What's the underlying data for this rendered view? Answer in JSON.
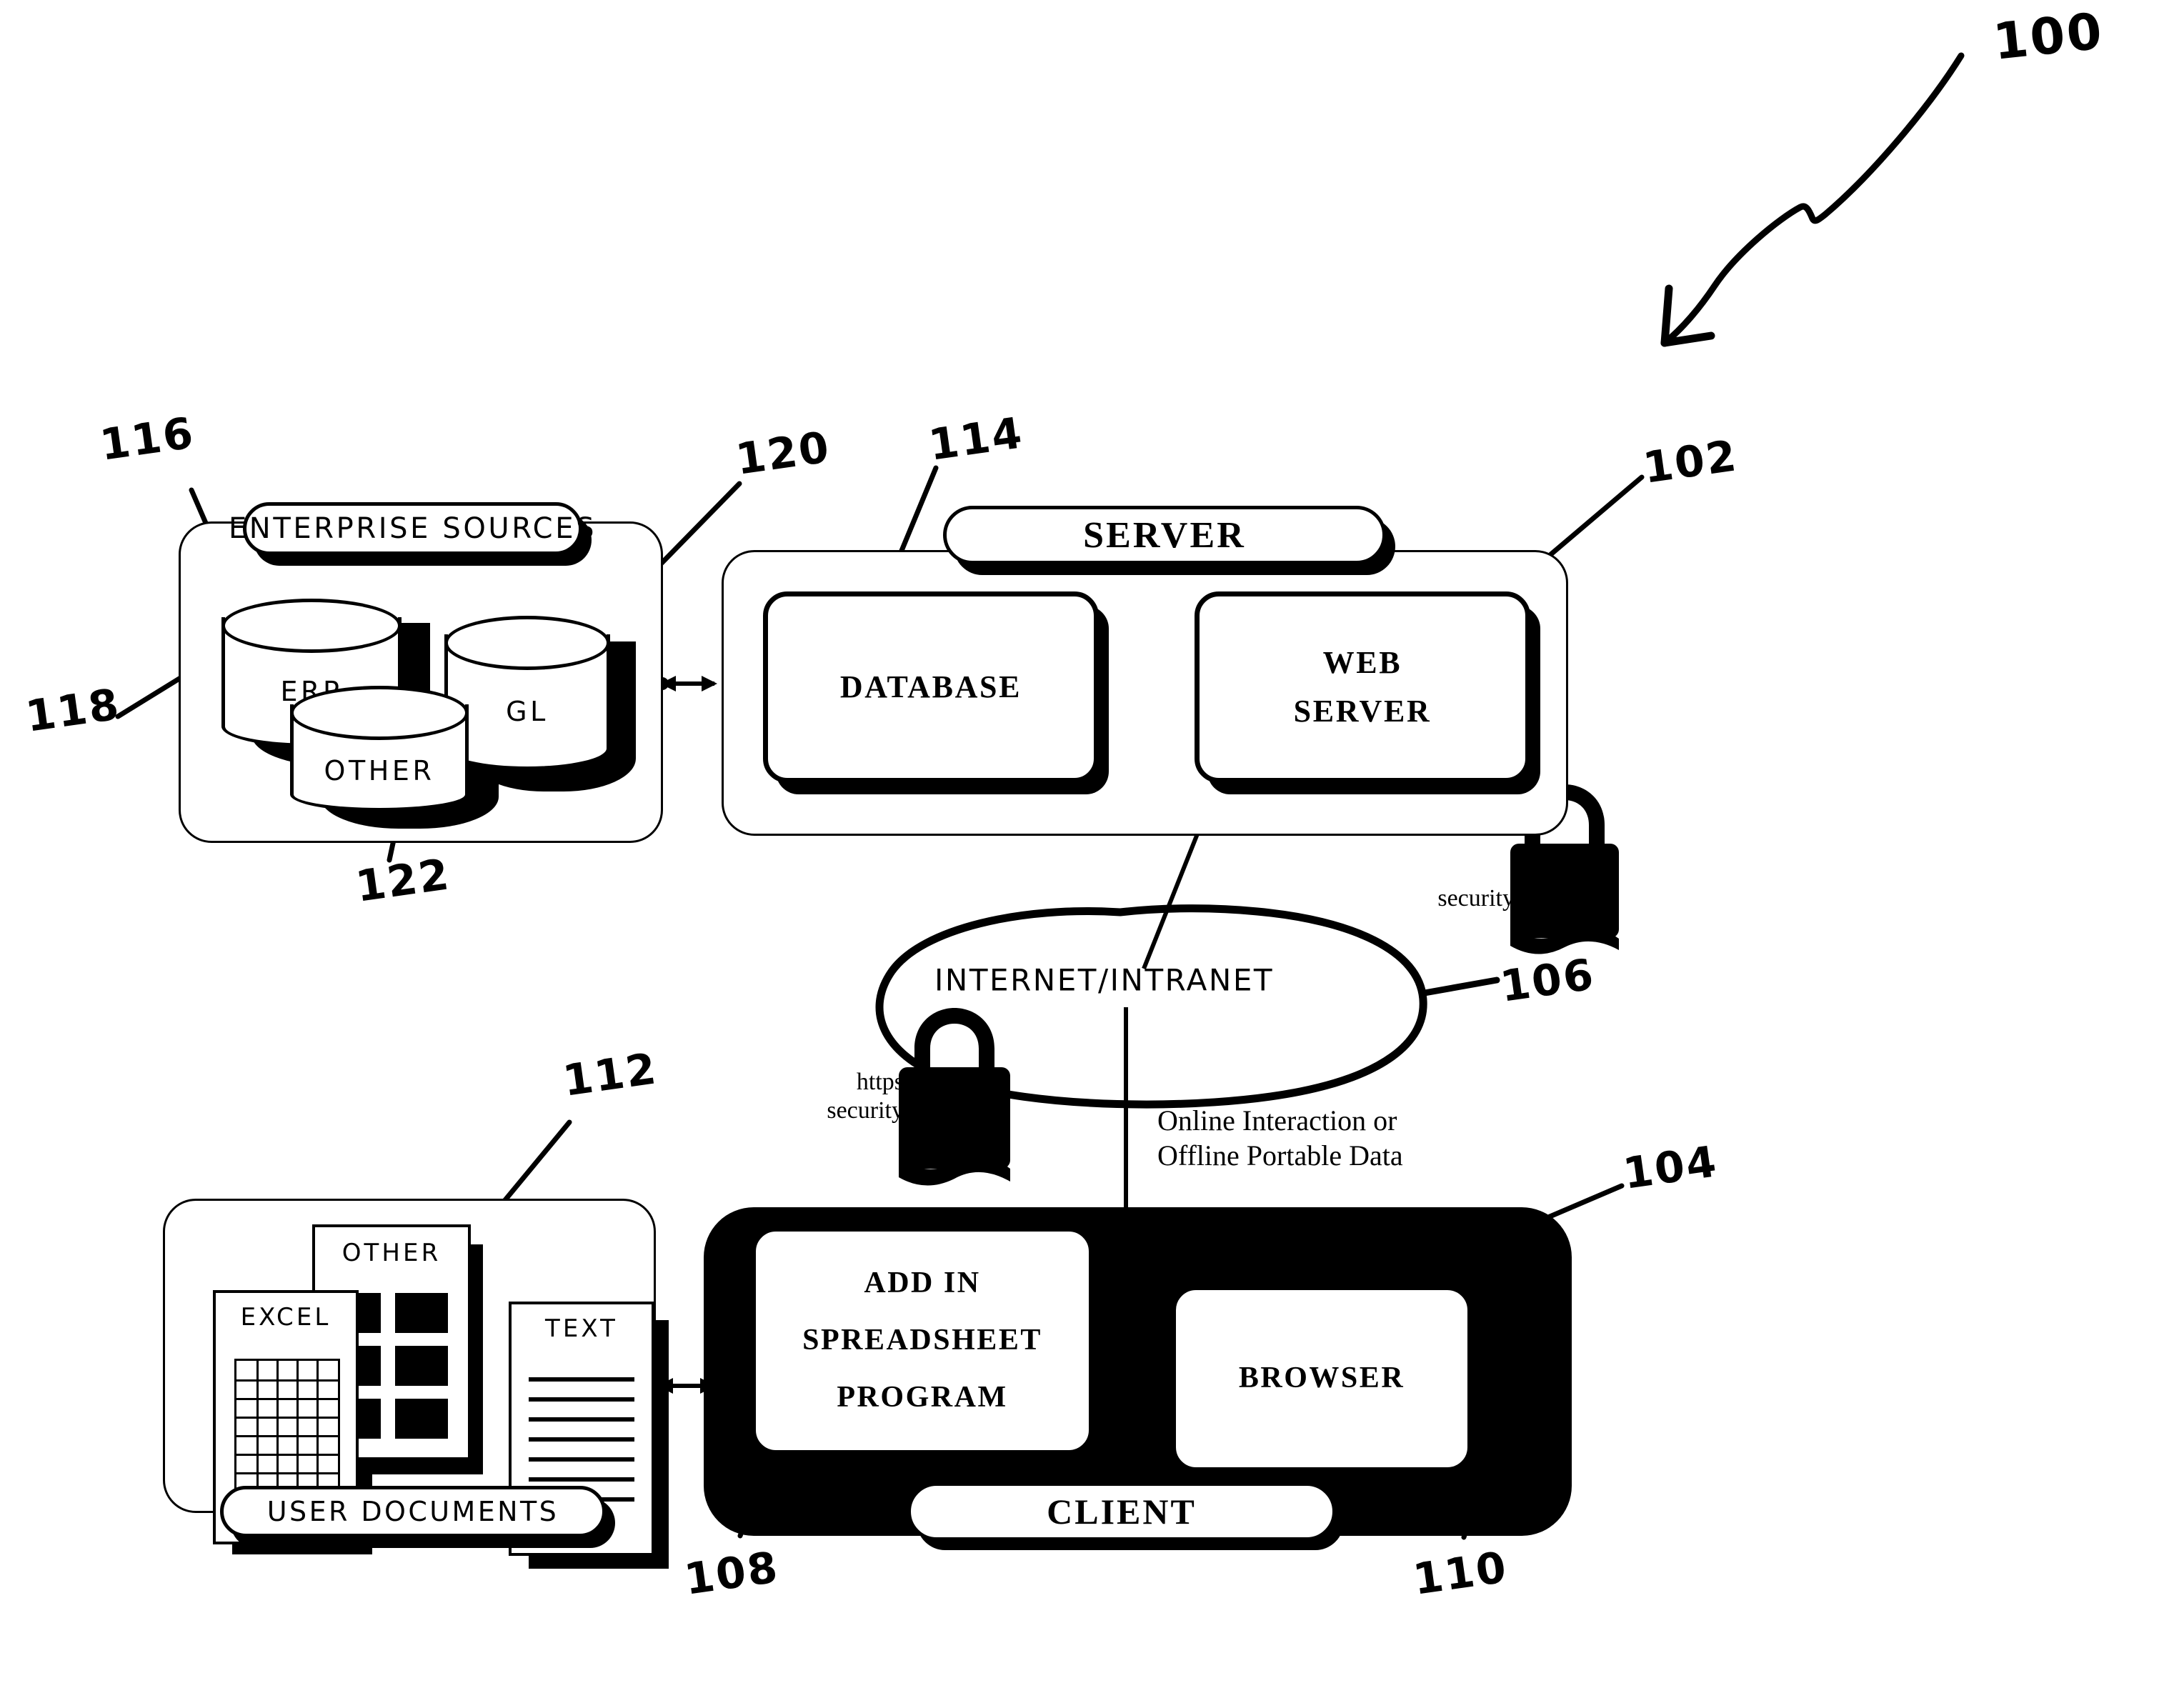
{
  "figure": {
    "reference_numeral": "100"
  },
  "refs": {
    "system": "100",
    "web_server": "102",
    "client": "104",
    "network": "106",
    "add_in_spreadsheet_program": "108",
    "browser": "110",
    "user_documents": "112",
    "database": "114",
    "enterprise_sources": "116",
    "erp": "118",
    "gl": "120",
    "other": "122"
  },
  "enterprise_sources": {
    "title": "ENTERPRISE SOURCES",
    "sources": [
      {
        "label": "ERP"
      },
      {
        "label": "GL"
      },
      {
        "label": "OTHER"
      }
    ]
  },
  "server": {
    "title": "SERVER",
    "nodes": [
      {
        "label": "DATABASE"
      },
      {
        "label": "WEB\nSERVER"
      }
    ],
    "security_label": "security",
    "security_icon": "padlock-icon"
  },
  "network": {
    "label": "INTERNET/INTRANET",
    "security_label": "https\nsecurity",
    "security_icon": "padlock-icon",
    "flow_label": "Online Interaction or\nOffline Portable Data"
  },
  "client": {
    "title": "CLIENT",
    "nodes": [
      {
        "label": "ADD IN\nSPREADSHEET\nPROGRAM"
      },
      {
        "label": "BROWSER"
      }
    ]
  },
  "user_documents": {
    "title": "USER DOCUMENTS",
    "documents": [
      {
        "label": "EXCEL",
        "kind": "spreadsheet-grid"
      },
      {
        "label": "OTHER",
        "kind": "image-tiles"
      },
      {
        "label": "TEXT",
        "kind": "text-lines"
      }
    ]
  },
  "connectors": [
    {
      "name": "enterprise-to-server",
      "style": "double-arrow"
    },
    {
      "name": "database-to-web-server",
      "style": "line"
    },
    {
      "name": "web-server-to-network",
      "style": "line"
    },
    {
      "name": "network-to-client",
      "style": "line"
    },
    {
      "name": "user-documents-to-client",
      "style": "double-arrow"
    }
  ],
  "colors": {
    "ink": "#000000",
    "paper": "#ffffff"
  }
}
